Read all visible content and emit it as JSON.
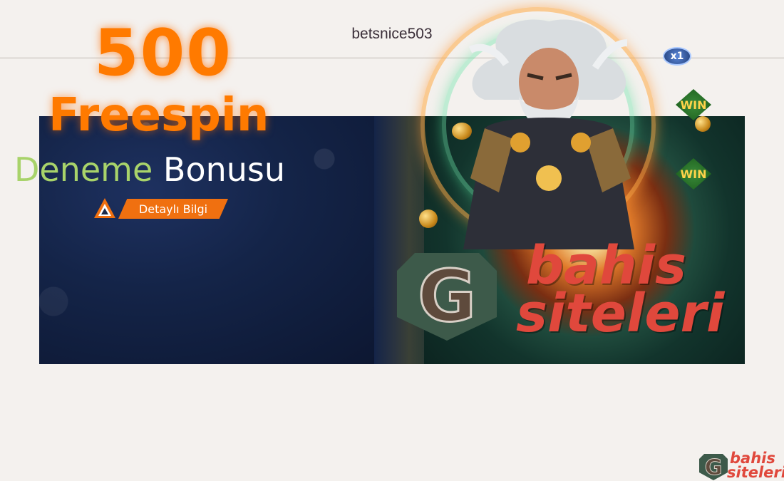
{
  "header": {
    "site_title": "betsnice503"
  },
  "banner": {
    "headline_number": "500",
    "headline_word": "Freespin",
    "subline_part1": "Deneme",
    "subline_part2": "Bonusu",
    "cta_label": "Detaylı Bilgi",
    "badge_multiplier": "x1",
    "badge_win": "WIN",
    "brand_line1": "bahis",
    "brand_line2": "siteleri",
    "brand_letter": "G"
  },
  "footer_logo": {
    "line1": "bahis",
    "line2": "siteleri"
  },
  "colors": {
    "accent_orange": "#ff7a00",
    "accent_green": "#a8d36a",
    "brand_red": "#e0483c",
    "shield_green": "#3d5a4a"
  },
  "icons": [
    "cta-logo-icon",
    "g-shield-icon",
    "zeus-illustration"
  ]
}
